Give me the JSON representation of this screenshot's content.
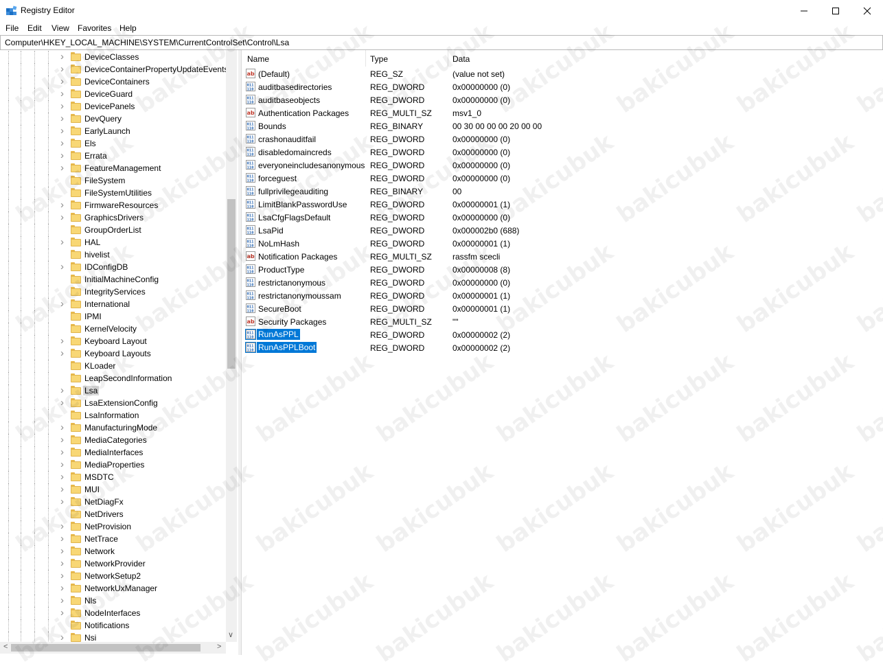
{
  "window": {
    "title": "Registry Editor"
  },
  "menu": [
    "File",
    "Edit",
    "View",
    "Favorites",
    "Help"
  ],
  "address": "Computer\\HKEY_LOCAL_MACHINE\\SYSTEM\\CurrentControlSet\\Control\\Lsa",
  "tree": {
    "items": [
      {
        "label": "DeviceClasses",
        "expandable": true
      },
      {
        "label": "DeviceContainerPropertyUpdateEvents",
        "expandable": true
      },
      {
        "label": "DeviceContainers",
        "expandable": true
      },
      {
        "label": "DeviceGuard",
        "expandable": true
      },
      {
        "label": "DevicePanels",
        "expandable": true
      },
      {
        "label": "DevQuery",
        "expandable": true
      },
      {
        "label": "EarlyLaunch",
        "expandable": true
      },
      {
        "label": "Els",
        "expandable": true
      },
      {
        "label": "Errata",
        "expandable": true
      },
      {
        "label": "FeatureManagement",
        "expandable": true
      },
      {
        "label": "FileSystem",
        "expandable": false
      },
      {
        "label": "FileSystemUtilities",
        "expandable": false
      },
      {
        "label": "FirmwareResources",
        "expandable": true
      },
      {
        "label": "GraphicsDrivers",
        "expandable": true
      },
      {
        "label": "GroupOrderList",
        "expandable": false
      },
      {
        "label": "HAL",
        "expandable": true
      },
      {
        "label": "hivelist",
        "expandable": false
      },
      {
        "label": "IDConfigDB",
        "expandable": true
      },
      {
        "label": "InitialMachineConfig",
        "expandable": false
      },
      {
        "label": "IntegrityServices",
        "expandable": false
      },
      {
        "label": "International",
        "expandable": true
      },
      {
        "label": "IPMI",
        "expandable": false
      },
      {
        "label": "KernelVelocity",
        "expandable": false
      },
      {
        "label": "Keyboard Layout",
        "expandable": true
      },
      {
        "label": "Keyboard Layouts",
        "expandable": true
      },
      {
        "label": "KLoader",
        "expandable": false
      },
      {
        "label": "LeapSecondInformation",
        "expandable": false
      },
      {
        "label": "Lsa",
        "expandable": true,
        "selected": true
      },
      {
        "label": "LsaExtensionConfig",
        "expandable": true
      },
      {
        "label": "LsaInformation",
        "expandable": false
      },
      {
        "label": "ManufacturingMode",
        "expandable": true
      },
      {
        "label": "MediaCategories",
        "expandable": true
      },
      {
        "label": "MediaInterfaces",
        "expandable": true
      },
      {
        "label": "MediaProperties",
        "expandable": true
      },
      {
        "label": "MSDTC",
        "expandable": true
      },
      {
        "label": "MUI",
        "expandable": true
      },
      {
        "label": "NetDiagFx",
        "expandable": true
      },
      {
        "label": "NetDrivers",
        "expandable": false
      },
      {
        "label": "NetProvision",
        "expandable": true
      },
      {
        "label": "NetTrace",
        "expandable": true
      },
      {
        "label": "Network",
        "expandable": true
      },
      {
        "label": "NetworkProvider",
        "expandable": true
      },
      {
        "label": "NetworkSetup2",
        "expandable": true
      },
      {
        "label": "NetworkUxManager",
        "expandable": true
      },
      {
        "label": "Nls",
        "expandable": true
      },
      {
        "label": "NodeInterfaces",
        "expandable": true
      },
      {
        "label": "Notifications",
        "expandable": false
      },
      {
        "label": "Nsi",
        "expandable": true
      }
    ]
  },
  "list": {
    "headers": {
      "name": "Name",
      "type": "Type",
      "data": "Data"
    },
    "rows": [
      {
        "icon": "string",
        "name": "(Default)",
        "type": "REG_SZ",
        "data": "(value not set)"
      },
      {
        "icon": "binary",
        "name": "auditbasedirectories",
        "type": "REG_DWORD",
        "data": "0x00000000 (0)"
      },
      {
        "icon": "binary",
        "name": "auditbaseobjects",
        "type": "REG_DWORD",
        "data": "0x00000000 (0)"
      },
      {
        "icon": "string",
        "name": "Authentication Packages",
        "type": "REG_MULTI_SZ",
        "data": "msv1_0"
      },
      {
        "icon": "binary",
        "name": "Bounds",
        "type": "REG_BINARY",
        "data": "00 30 00 00 00 20 00 00"
      },
      {
        "icon": "binary",
        "name": "crashonauditfail",
        "type": "REG_DWORD",
        "data": "0x00000000 (0)"
      },
      {
        "icon": "binary",
        "name": "disabledomaincreds",
        "type": "REG_DWORD",
        "data": "0x00000000 (0)"
      },
      {
        "icon": "binary",
        "name": "everyoneincludesanonymous",
        "type": "REG_DWORD",
        "data": "0x00000000 (0)"
      },
      {
        "icon": "binary",
        "name": "forceguest",
        "type": "REG_DWORD",
        "data": "0x00000000 (0)"
      },
      {
        "icon": "binary",
        "name": "fullprivilegeauditing",
        "type": "REG_BINARY",
        "data": "00"
      },
      {
        "icon": "binary",
        "name": "LimitBlankPasswordUse",
        "type": "REG_DWORD",
        "data": "0x00000001 (1)"
      },
      {
        "icon": "binary",
        "name": "LsaCfgFlagsDefault",
        "type": "REG_DWORD",
        "data": "0x00000000 (0)"
      },
      {
        "icon": "binary",
        "name": "LsaPid",
        "type": "REG_DWORD",
        "data": "0x000002b0 (688)"
      },
      {
        "icon": "binary",
        "name": "NoLmHash",
        "type": "REG_DWORD",
        "data": "0x00000001 (1)"
      },
      {
        "icon": "string",
        "name": "Notification Packages",
        "type": "REG_MULTI_SZ",
        "data": "rassfm scecli"
      },
      {
        "icon": "binary",
        "name": "ProductType",
        "type": "REG_DWORD",
        "data": "0x00000008 (8)"
      },
      {
        "icon": "binary",
        "name": "restrictanonymous",
        "type": "REG_DWORD",
        "data": "0x00000000 (0)"
      },
      {
        "icon": "binary",
        "name": "restrictanonymoussam",
        "type": "REG_DWORD",
        "data": "0x00000001 (1)"
      },
      {
        "icon": "binary",
        "name": "SecureBoot",
        "type": "REG_DWORD",
        "data": "0x00000001 (1)"
      },
      {
        "icon": "string",
        "name": "Security Packages",
        "type": "REG_MULTI_SZ",
        "data": "\"\""
      },
      {
        "icon": "binary",
        "name": "RunAsPPL",
        "type": "REG_DWORD",
        "data": "0x00000002 (2)",
        "selected": true
      },
      {
        "icon": "binary",
        "name": "RunAsPPLBoot",
        "type": "REG_DWORD",
        "data": "0x00000002 (2)",
        "selected": true
      }
    ]
  },
  "watermark": "bakicubuk"
}
